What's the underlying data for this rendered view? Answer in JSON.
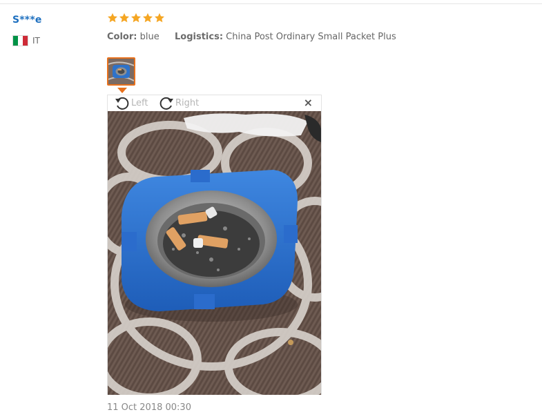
{
  "review": {
    "user_name": "S***e",
    "country_code": "IT",
    "flag_colors": [
      "#009246",
      "#ffffff",
      "#ce2b37"
    ],
    "rating": 5,
    "rating_max": 5,
    "star_color": "#f5a623",
    "attributes": [
      {
        "label": "Color:",
        "value": "blue"
      },
      {
        "label": "Logistics:",
        "value": "China Post Ordinary Small Packet Plus"
      }
    ],
    "date": "11 Oct 2018 00:30"
  },
  "viewer": {
    "rotate_left_label": "Left",
    "rotate_right_label": "Right",
    "close_glyph": "×",
    "accent_color": "#e8711c"
  }
}
